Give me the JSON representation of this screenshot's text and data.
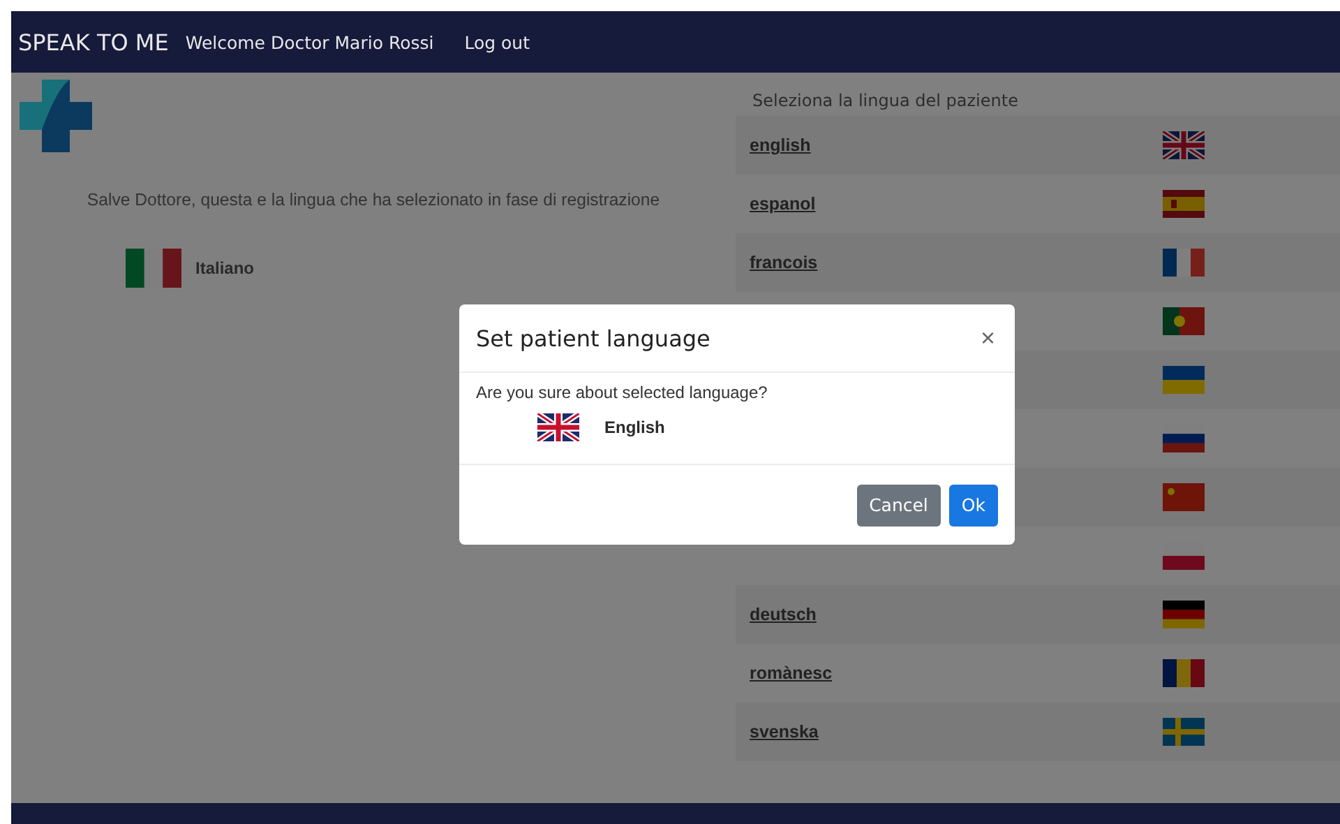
{
  "navbar": {
    "brand": "SPEAK TO ME",
    "welcome": "Welcome Doctor Mario Rossi",
    "logout": "Log out"
  },
  "registered": {
    "message": "Salve Dottore, questa e la lingua che ha selezionato in fase di registrazione",
    "language": "Italiano",
    "kind": "it"
  },
  "language_list": {
    "title": "Seleziona la lingua del paziente",
    "items": [
      {
        "label": "english",
        "kind": "uk"
      },
      {
        "label": "espanol",
        "kind": "es"
      },
      {
        "label": "francois",
        "kind": "fr"
      },
      {
        "kind": "pt"
      },
      {
        "kind": "ua"
      },
      {
        "kind": "ru"
      },
      {
        "kind": "cn"
      },
      {
        "kind": "pl"
      },
      {
        "label": "deutsch",
        "kind": "de"
      },
      {
        "label": "romànesc",
        "kind": "ro"
      },
      {
        "label": "svenska",
        "kind": "se"
      }
    ]
  },
  "dialog": {
    "title": "Set patient language",
    "close": "×",
    "question": "Are you sure about selected language?",
    "language": "English",
    "kind": "uk",
    "buttons": [
      {
        "label": "Cancel",
        "kind": "secondary"
      },
      {
        "label": "Ok",
        "kind": "primary"
      }
    ]
  }
}
